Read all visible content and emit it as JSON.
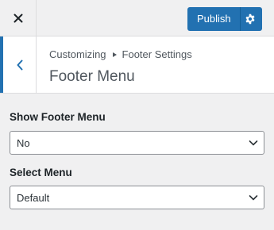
{
  "header": {
    "publish_label": "Publish"
  },
  "section": {
    "breadcrumb_root": "Customizing",
    "breadcrumb_parent": "Footer Settings",
    "title": "Footer Menu"
  },
  "controls": {
    "show_footer_menu": {
      "label": "Show Footer Menu",
      "value": "No"
    },
    "select_menu": {
      "label": "Select Menu",
      "value": "Default"
    }
  },
  "colors": {
    "accent": "#2271b1",
    "background": "#f0f0f1",
    "panel": "#ffffff"
  },
  "icons": {
    "close": "close-icon",
    "settings": "gear-icon",
    "back": "chevron-left-icon",
    "dropdown": "chevron-down-icon"
  }
}
